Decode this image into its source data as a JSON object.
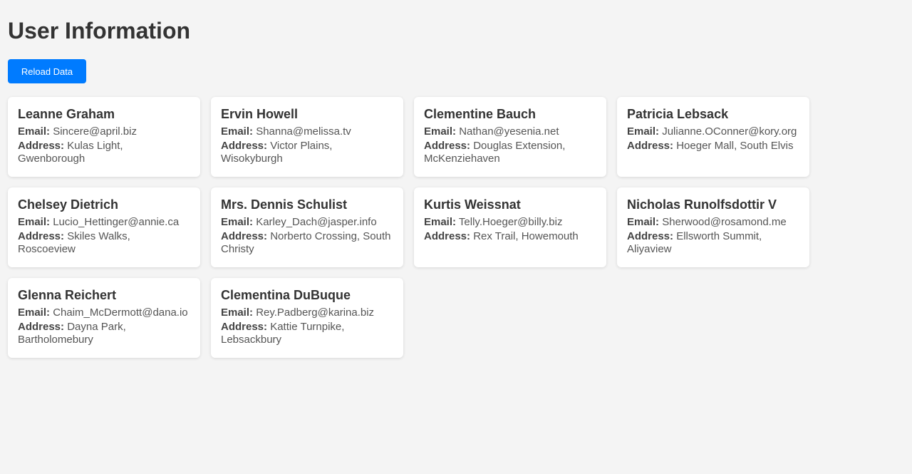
{
  "header": {
    "title": "User Information",
    "reload_label": "Reload Data"
  },
  "labels": {
    "email": "Email:",
    "address": "Address:"
  },
  "users": [
    {
      "name": "Leanne Graham",
      "email": "Sincere@april.biz",
      "address": "Kulas Light, Gwenborough"
    },
    {
      "name": "Ervin Howell",
      "email": "Shanna@melissa.tv",
      "address": "Victor Plains, Wisokyburgh"
    },
    {
      "name": "Clementine Bauch",
      "email": "Nathan@yesenia.net",
      "address": "Douglas Extension, McKenziehaven"
    },
    {
      "name": "Patricia Lebsack",
      "email": "Julianne.OConner@kory.org",
      "address": "Hoeger Mall, South Elvis"
    },
    {
      "name": "Chelsey Dietrich",
      "email": "Lucio_Hettinger@annie.ca",
      "address": "Skiles Walks, Roscoeview"
    },
    {
      "name": "Mrs. Dennis Schulist",
      "email": "Karley_Dach@jasper.info",
      "address": "Norberto Crossing, South Christy"
    },
    {
      "name": "Kurtis Weissnat",
      "email": "Telly.Hoeger@billy.biz",
      "address": "Rex Trail, Howemouth"
    },
    {
      "name": "Nicholas Runolfsdottir V",
      "email": "Sherwood@rosamond.me",
      "address": "Ellsworth Summit, Aliyaview"
    },
    {
      "name": "Glenna Reichert",
      "email": "Chaim_McDermott@dana.io",
      "address": "Dayna Park, Bartholomebury"
    },
    {
      "name": "Clementina DuBuque",
      "email": "Rey.Padberg@karina.biz",
      "address": "Kattie Turnpike, Lebsackbury"
    }
  ],
  "colors": {
    "accent": "#007bff",
    "background": "#f4f4f4",
    "card": "#ffffff"
  }
}
